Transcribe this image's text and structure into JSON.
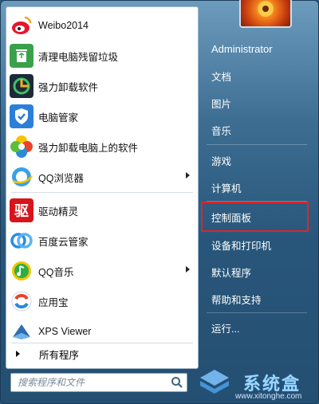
{
  "left_items": [
    {
      "label": "Weibo2014",
      "icon": "weibo-icon",
      "has_submenu": false
    },
    {
      "label": "清理电脑残留垃圾",
      "icon": "recycle-icon",
      "has_submenu": false
    },
    {
      "label": "强力卸载软件",
      "icon": "uninstall-icon",
      "has_submenu": false
    },
    {
      "label": "电脑管家",
      "icon": "shield-icon",
      "has_submenu": false
    },
    {
      "label": "强力卸载电脑上的软件",
      "icon": "pinwheel-icon",
      "has_submenu": false
    },
    {
      "label": "QQ浏览器",
      "icon": "qq-browser-icon",
      "has_submenu": true
    },
    {
      "label": "驱动精灵",
      "icon": "driver-icon",
      "has_submenu": false
    },
    {
      "label": "百度云管家",
      "icon": "cloud-icon",
      "has_submenu": false
    },
    {
      "label": "QQ音乐",
      "icon": "music-icon",
      "has_submenu": true
    },
    {
      "label": "应用宝",
      "icon": "app-store-icon",
      "has_submenu": false
    },
    {
      "label": "XPS Viewer",
      "icon": "xps-icon",
      "has_submenu": false
    }
  ],
  "all_programs": "所有程序",
  "search_placeholder": "搜索程序和文件",
  "right_items": {
    "user": "Administrator",
    "documents": "文档",
    "pictures": "图片",
    "music": "音乐",
    "games": "游戏",
    "computer": "计算机",
    "control_panel": "控制面板",
    "devices": "设备和打印机",
    "default_programs": "默认程序",
    "help": "帮助和支持",
    "run": "运行..."
  },
  "watermark": {
    "brand": "系统盒",
    "url": "www.xitonghe.com"
  },
  "colors": {
    "highlight": "#e0242b",
    "panel": "#28567a"
  }
}
